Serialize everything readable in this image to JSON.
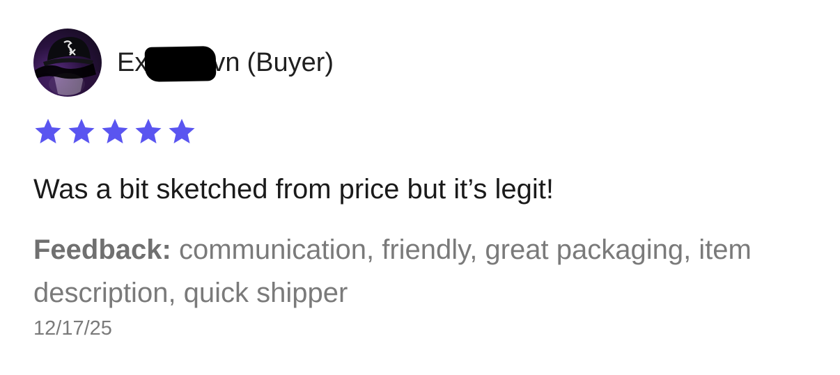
{
  "review": {
    "reviewer": {
      "name_prefix": "Ex",
      "name_suffix": "vn",
      "role": "(Buyer)",
      "avatar_icon": "avatar-photo-icon"
    },
    "rating": {
      "value": 5,
      "max": 5,
      "star_color": "#5a55f0",
      "star_icon": "star-icon"
    },
    "comment": "Was a bit sketched from price but it’s legit!",
    "feedback": {
      "label": "Feedback:",
      "items": "communication, friendly, great packaging, item description, quick shipper"
    },
    "date": "12/17/25"
  }
}
